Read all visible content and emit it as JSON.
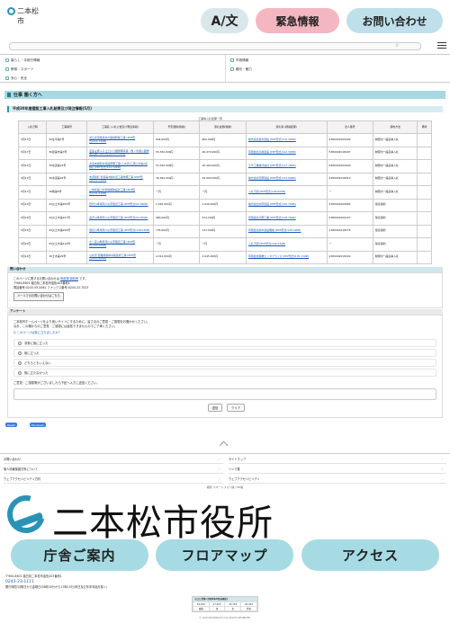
{
  "header": {
    "logo_text": "二本松市",
    "lang_label": "A/文",
    "emergency_label": "緊急情報",
    "contact_label": "お問い合わせ"
  },
  "nav": {
    "items": [
      "暮らし・手続き情報",
      "市政情報",
      "教育・スポーツ",
      "観光・魅力",
      "安心・安全"
    ]
  },
  "page": {
    "title": "仕事 働く方へ",
    "section_title": "平成30年度建設工事入札結果及び発注情報(5月)",
    "table_caption": "工事等入札結果一覧"
  },
  "table": {
    "headers": [
      "入札日時",
      "工事番号",
      "工事名 (入札公告及び発注情報)",
      "予定価格(税抜)",
      "落札金額(税抜)",
      "落札者 (経審結果)",
      "法人番号",
      "契約方法",
      "備考"
    ],
    "rows": [
      [
        "5月17日",
        "30生平第1号",
        "渡山手足路海水大路線防除工事 [PDF形式/216.74KB]",
        "844,000円",
        "800,000円",
        "株式会社岩水建設 [PDF形式/110.40KB]",
        "6380001000009",
        "制限付一般競争入札",
        ""
      ],
      [
        "5月17日",
        "30建第市第3号",
        "宇多々豊ふるさと川公園整備基盤（牧ノ内通公園整備工事）[PDF形式/225.56KB]",
        "55,530,000円",
        "46,970,000円",
        "有限会社高峰建設 [PDF形式/142.30KB]",
        "5380002018497",
        "制限付一般競争入札",
        ""
      ],
      [
        "5月17日",
        "30水道第23号",
        "水道本線配水施設整備工事(上水道(三浦上水第2水線)) [PDF形式/125.59KB]",
        "53,340,000円",
        "45,400,000円",
        "大平工業株式会社 [PDF形式/137.76KB]",
        "6380001004000",
        "制限付一般競争入札",
        ""
      ],
      [
        "5月17日",
        "30水道第24号",
        "市道和町 管道第3線水道工事整備工事 [PDF形式/211.79KB]",
        "36,390,000円",
        "29,000,000円",
        "株式会社安部建設 [PDF形式/134.90KB]",
        "5380002018910",
        "制限付一般競争入札",
        ""
      ],
      [
        "5月17日",
        "30教第6号",
        "二本松第二中学校解体設計工事 [PDF形式/231.51KB]",
        "一円",
        "一円",
        "入札不調 [PDF形式/109.65KB]",
        "一",
        "制限付一般競争入札",
        ""
      ],
      [
        "5月23日",
        "29災土木第205号",
        "田代川準用河川災害復旧工事 [PDF形式/92.59KB]",
        "1,050,000円",
        "1,020,000円",
        "株式会社水原建設 [PDF形式/126.74KB]",
        "3380001009689",
        "随意契約",
        ""
      ],
      [
        "5月23日",
        "29災土木第107号",
        "鬼沢川準用河川災害復旧工事 [PDF形式/93.87KB]",
        "980,000円",
        "974,000円",
        "有限会社高野工業 [PDF形式/128.76KB]",
        "5380001009470",
        "随意契約",
        ""
      ],
      [
        "5月23日",
        "29災土木第109号",
        "堀切川準用河川災害復旧工事 [PDF形式/128.03KB]",
        "735,000円",
        "723,000円",
        "有限会社鈴木建設機械 [PDF形式/128.59KB]",
        "1380001018278",
        "随意契約",
        ""
      ],
      [
        "5月23日",
        "29災土木第110号",
        "ホッ宮川準用河川災害復旧工事 [PDF形式/220.56KB]",
        "一円",
        "一円",
        "入札不調 [PDF形式/109.53KB]",
        "一",
        "随意契約",
        ""
      ],
      [
        "5月13日",
        "30土木第29号",
        "小谷沢 農業用用排水路改修工事 [PDF形式/225.98KB]",
        "4,312,000円",
        "3,645,000円",
        "有限会社藤橋エンタプライズ [PDF形式/135.13KB]",
        "4380002018449",
        "制限付一般競争入札",
        ""
      ]
    ]
  },
  "inquiry": {
    "heading": "問い合わせ",
    "line1": "このページに関するお問い合わせは",
    "link": "財政課 契約係",
    "line2": "です。",
    "addr": "〒964-8601 福島県二本松市金色403番地1",
    "tel": "電話番号:0243-55-5061 ファックス番号:0243-22-7023",
    "mail_button": "メールでのお問い合わせはこちら"
  },
  "survey": {
    "heading": "アンケート",
    "intro1": "二本松市ホームページをより良いサイトにするために、皆さまのご意見・ご感想をお聞かせください。",
    "intro2": "なお、この欄からのご意見・ご感想には返答できませんのでご了承ください。",
    "q1": "Q このページは役に立ちましたか？",
    "options": [
      "非常に役に立った",
      "役に立った",
      "どちらともいえない",
      "役に立たなかった"
    ],
    "q2": "ご意見・ご感想等がございましたら下記へ入力し送信ください。",
    "submit": "送信",
    "clear": "クリア"
  },
  "share": {
    "twitter": "Tweet",
    "facebook": "Facebook"
  },
  "footer_links": [
    "お問い合わせ",
    "サイトマップ",
    "個人情報保護方針について",
    "リンク集",
    "ウェブアクセシビリティ方針",
    "ウェブアクセシビリティ"
  ],
  "small_links": "検索  スマートフォン版  |  PC版",
  "brand": {
    "name": "二本松市役所"
  },
  "buttons": {
    "guide": "庁舎ご案内",
    "floor": "フロアマップ",
    "access": "アクセス"
  },
  "address": {
    "line1": "〒964-8601 福島県二本松市金色403番地1",
    "tel": "0243-23-1111",
    "hours": "開庁時間:月曜日から金曜日の8時30分から17時15分(祝日及び年末年始を除く)"
  },
  "stats": {
    "title": "人口と世帯 (令和X年X月末現在)",
    "values": [
      "52,XXX",
      "27,2XX",
      "25,7XX",
      "20,XXX"
    ],
    "labels": [
      "総数",
      "男",
      "女",
      "世帯"
    ]
  },
  "copyright": "© 2019 NIHONMATSU ALL RIGHTS RESERVED."
}
